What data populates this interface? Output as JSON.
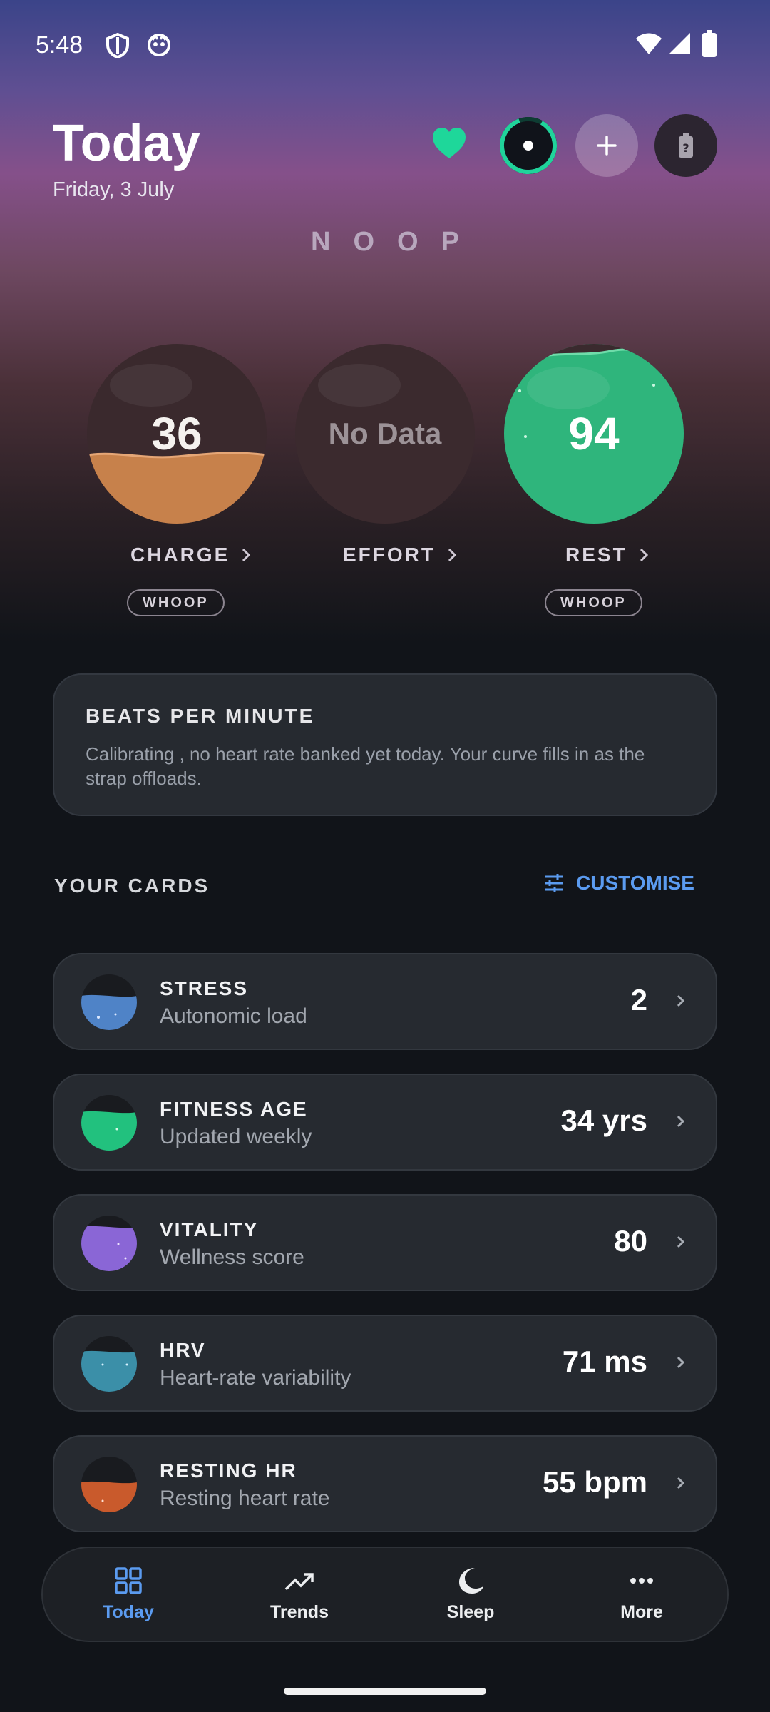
{
  "status_bar": {
    "time": "5:48"
  },
  "header": {
    "title": "Today",
    "date": "Friday, 3 July",
    "brand": "NOOP",
    "icons": [
      "heart-icon",
      "activity-ring-icon",
      "plus-icon",
      "battery-unknown-icon"
    ]
  },
  "scores": [
    {
      "value": "36",
      "label": "CHARGE",
      "badge": "WHOOP",
      "fill_percent": 36,
      "color": "#c7814b"
    },
    {
      "value": "No Data",
      "label": "EFFORT",
      "badge": "",
      "fill_percent": 0,
      "color": "#3a2a2e"
    },
    {
      "value": "94",
      "label": "REST",
      "badge": "WHOOP",
      "fill_percent": 94,
      "color": "#2fb57c"
    }
  ],
  "bpm_card": {
    "title": "BEATS PER MINUTE",
    "text": "Calibrating , no heart rate banked yet today. Your curve fills in as the strap offloads."
  },
  "cards_section": {
    "label": "YOUR CARDS",
    "customise": "CUSTOMISE"
  },
  "cards": [
    {
      "title": "STRESS",
      "subtitle": "Autonomic load",
      "value": "2",
      "color": "#4f83c7",
      "fill_percent": 55
    },
    {
      "title": "FITNESS AGE",
      "subtitle": "Updated weekly",
      "value": "34 yrs",
      "color": "#22c17e",
      "fill_percent": 65
    },
    {
      "title": "VITALITY",
      "subtitle": "Wellness score",
      "value": "80",
      "color": "#8a66d6",
      "fill_percent": 80
    },
    {
      "title": "HRV",
      "subtitle": "Heart-rate variability",
      "value": "71 ms",
      "color": "#3b8fa8",
      "fill_percent": 70
    },
    {
      "title": "RESTING HR",
      "subtitle": "Resting heart rate",
      "value": "55 bpm",
      "color": "#c95a2c",
      "fill_percent": 55
    }
  ],
  "nav": [
    {
      "label": "Today",
      "icon": "grid-icon",
      "active": true
    },
    {
      "label": "Trends",
      "icon": "trend-icon",
      "active": false
    },
    {
      "label": "Sleep",
      "icon": "moon-icon",
      "active": false
    },
    {
      "label": "More",
      "icon": "more-icon",
      "active": false
    }
  ]
}
